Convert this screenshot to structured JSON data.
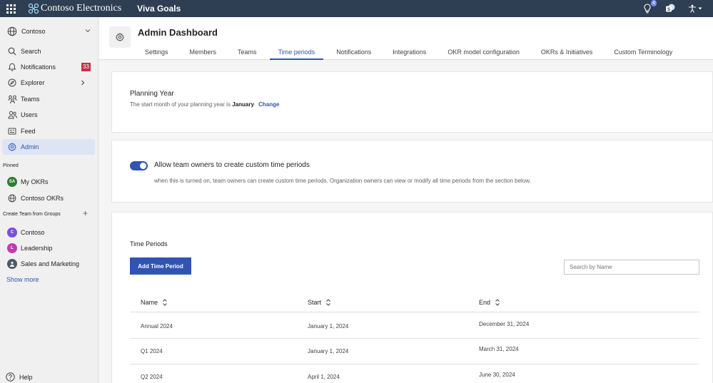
{
  "topbar": {
    "brand_name": "Contoso Electronics",
    "app_name": "Viva Goals",
    "bulb_count": "4",
    "bg_color": "#2e3e53"
  },
  "nav": {
    "org": "Contoso",
    "items": [
      {
        "label": "Search",
        "icon": "search-icon"
      },
      {
        "label": "Notifications",
        "icon": "bell-icon",
        "badge": "33"
      },
      {
        "label": "Explorer",
        "icon": "compass-icon"
      },
      {
        "label": "Teams",
        "icon": "teams-icon"
      },
      {
        "label": "Users",
        "icon": "users-icon"
      },
      {
        "label": "Feed",
        "icon": "feed-icon"
      },
      {
        "label": "Admin",
        "icon": "gear-icon",
        "active": true
      }
    ],
    "pinned_label": "Pinned",
    "pinned": [
      {
        "label": "My OKRs",
        "avatar": "SA"
      },
      {
        "label": "Contoso OKRs",
        "icon": "globe-icon"
      }
    ],
    "groups_label": "Create Team from Groups",
    "groups": [
      {
        "label": "Contoso",
        "avatar": "C",
        "color": "#7b4fd8"
      },
      {
        "label": "Leadership",
        "avatar": "L",
        "color": "#c239b3"
      },
      {
        "label": "Sales and Marketing",
        "avatar": "",
        "color": "#4a5a6a"
      }
    ],
    "show_more": "Show more",
    "help": "Help"
  },
  "header": {
    "title": "Admin Dashboard",
    "tabs": [
      "Settings",
      "Members",
      "Teams",
      "Time periods",
      "Notifications",
      "Integrations",
      "OKR model configuration",
      "OKRs & Initiatives",
      "Custom Terminology"
    ],
    "active_tab": "Time periods"
  },
  "planning": {
    "title": "Planning Year",
    "sub_prefix": "The start month of your planning year is",
    "month": "January",
    "change": "Change"
  },
  "custom_periods": {
    "title": "Allow team owners to create custom time periods",
    "description": "when this is turned on, team owners can create custom time periods. Organization owners can view or modify all time periods from the section below.",
    "enabled": true
  },
  "time_periods": {
    "title": "Time Periods",
    "add_button": "Add Time Period",
    "search_placeholder": "Search by Name",
    "columns": [
      "Name",
      "Start",
      "End"
    ],
    "rows": [
      {
        "name": "Annual 2024",
        "start": "January 1, 2024",
        "end": "December 31, 2024"
      },
      {
        "name": "Q1 2024",
        "start": "January 1, 2024",
        "end": "March 31, 2024"
      },
      {
        "name": "Q2 2024",
        "start": "April 1, 2024",
        "end": "June 30, 2024"
      }
    ]
  },
  "colors": {
    "accent": "#3154b3",
    "badge": "#c4314b"
  }
}
